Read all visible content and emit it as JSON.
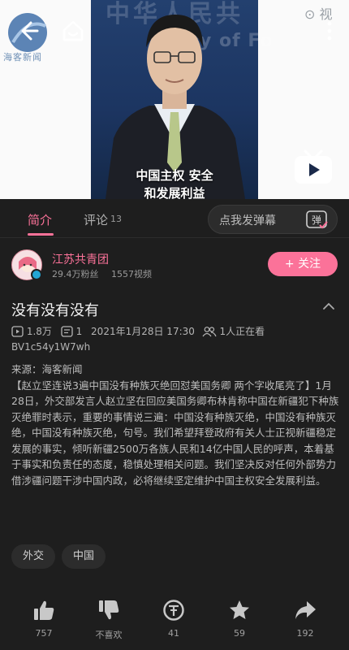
{
  "video": {
    "logo_text": "海客新闻",
    "watermark": "⊙ 视",
    "wall_text_top": "中华人民共",
    "wall_text_mid": "istry of Fo",
    "subtitle_line1": "中国主权 安全",
    "subtitle_line2": "和发展利益"
  },
  "tabs": {
    "intro": "简介",
    "comment": "评论",
    "comment_count": "13"
  },
  "danmaku": {
    "placeholder": "点我发弹幕",
    "button_label": "弹"
  },
  "uploader": {
    "name": "江苏共青团",
    "fans": "29.4万粉丝",
    "videos": "1557视频",
    "follow_label": "+ 关注"
  },
  "video_info": {
    "title": "没有没有没有",
    "views": "1.8万",
    "danmaku_count": "1",
    "date": "2021年1月28日 17:30",
    "watching": "1人正在看",
    "bvid": "BV1c54y1W7wh"
  },
  "description": {
    "source": "来源：海客新闻",
    "body": "【赵立坚连说3遍中国没有种族灭绝回怼美国务卿 两个字收尾亮了】1月28日，外交部发言人赵立坚在回应美国务卿布林肯称中国在新疆犯下种族灭绝罪时表示，重要的事情说三遍：中国没有种族灭绝，中国没有种族灭绝，中国没有种族灭绝，句号。我们希望拜登政府有关人士正视新疆稳定发展的事实，倾听新疆2500万各族人民和14亿中国人民的呼声，本着基于事实和负责任的态度，稳慎处理相关问题。我们坚决反对任何外部势力借涉疆问题干涉中国内政，必将继续坚定维护中国主权安全发展利益。"
  },
  "tags": [
    "外交",
    "中国"
  ],
  "actions": {
    "like": "757",
    "dislike": "不喜欢",
    "coin": "41",
    "favorite": "59",
    "share": "192"
  },
  "colors": {
    "accent": "#fb7299",
    "background": "#1e1e1e"
  }
}
